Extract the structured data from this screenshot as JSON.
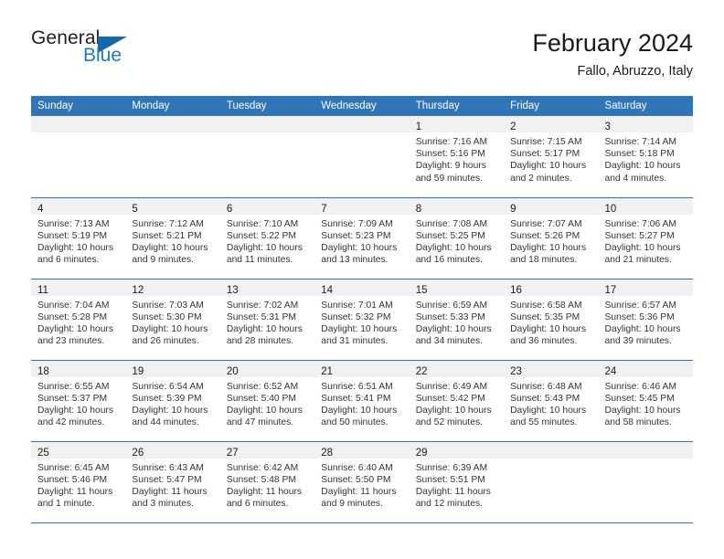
{
  "brand": {
    "name_part1": "General",
    "name_part2": "Blue",
    "logo_icon": "triangle-logo-icon"
  },
  "header": {
    "title": "February 2024",
    "subtitle": "Fallo, Abruzzo, Italy"
  },
  "colors": {
    "header_blue": "#2E76B8",
    "brand_blue": "#1E7AC4",
    "daynum_strip": "#F1F1F1",
    "text": "#333333"
  },
  "weekday_headers": [
    "Sunday",
    "Monday",
    "Tuesday",
    "Wednesday",
    "Thursday",
    "Friday",
    "Saturday"
  ],
  "weeks": [
    [
      {
        "day": "",
        "lines": []
      },
      {
        "day": "",
        "lines": []
      },
      {
        "day": "",
        "lines": []
      },
      {
        "day": "",
        "lines": []
      },
      {
        "day": "1",
        "lines": [
          "Sunrise: 7:16 AM",
          "Sunset: 5:16 PM",
          "Daylight: 9 hours",
          "and 59 minutes."
        ]
      },
      {
        "day": "2",
        "lines": [
          "Sunrise: 7:15 AM",
          "Sunset: 5:17 PM",
          "Daylight: 10 hours",
          "and 2 minutes."
        ]
      },
      {
        "day": "3",
        "lines": [
          "Sunrise: 7:14 AM",
          "Sunset: 5:18 PM",
          "Daylight: 10 hours",
          "and 4 minutes."
        ]
      }
    ],
    [
      {
        "day": "4",
        "lines": [
          "Sunrise: 7:13 AM",
          "Sunset: 5:19 PM",
          "Daylight: 10 hours",
          "and 6 minutes."
        ]
      },
      {
        "day": "5",
        "lines": [
          "Sunrise: 7:12 AM",
          "Sunset: 5:21 PM",
          "Daylight: 10 hours",
          "and 9 minutes."
        ]
      },
      {
        "day": "6",
        "lines": [
          "Sunrise: 7:10 AM",
          "Sunset: 5:22 PM",
          "Daylight: 10 hours",
          "and 11 minutes."
        ]
      },
      {
        "day": "7",
        "lines": [
          "Sunrise: 7:09 AM",
          "Sunset: 5:23 PM",
          "Daylight: 10 hours",
          "and 13 minutes."
        ]
      },
      {
        "day": "8",
        "lines": [
          "Sunrise: 7:08 AM",
          "Sunset: 5:25 PM",
          "Daylight: 10 hours",
          "and 16 minutes."
        ]
      },
      {
        "day": "9",
        "lines": [
          "Sunrise: 7:07 AM",
          "Sunset: 5:26 PM",
          "Daylight: 10 hours",
          "and 18 minutes."
        ]
      },
      {
        "day": "10",
        "lines": [
          "Sunrise: 7:06 AM",
          "Sunset: 5:27 PM",
          "Daylight: 10 hours",
          "and 21 minutes."
        ]
      }
    ],
    [
      {
        "day": "11",
        "lines": [
          "Sunrise: 7:04 AM",
          "Sunset: 5:28 PM",
          "Daylight: 10 hours",
          "and 23 minutes."
        ]
      },
      {
        "day": "12",
        "lines": [
          "Sunrise: 7:03 AM",
          "Sunset: 5:30 PM",
          "Daylight: 10 hours",
          "and 26 minutes."
        ]
      },
      {
        "day": "13",
        "lines": [
          "Sunrise: 7:02 AM",
          "Sunset: 5:31 PM",
          "Daylight: 10 hours",
          "and 28 minutes."
        ]
      },
      {
        "day": "14",
        "lines": [
          "Sunrise: 7:01 AM",
          "Sunset: 5:32 PM",
          "Daylight: 10 hours",
          "and 31 minutes."
        ]
      },
      {
        "day": "15",
        "lines": [
          "Sunrise: 6:59 AM",
          "Sunset: 5:33 PM",
          "Daylight: 10 hours",
          "and 34 minutes."
        ]
      },
      {
        "day": "16",
        "lines": [
          "Sunrise: 6:58 AM",
          "Sunset: 5:35 PM",
          "Daylight: 10 hours",
          "and 36 minutes."
        ]
      },
      {
        "day": "17",
        "lines": [
          "Sunrise: 6:57 AM",
          "Sunset: 5:36 PM",
          "Daylight: 10 hours",
          "and 39 minutes."
        ]
      }
    ],
    [
      {
        "day": "18",
        "lines": [
          "Sunrise: 6:55 AM",
          "Sunset: 5:37 PM",
          "Daylight: 10 hours",
          "and 42 minutes."
        ]
      },
      {
        "day": "19",
        "lines": [
          "Sunrise: 6:54 AM",
          "Sunset: 5:39 PM",
          "Daylight: 10 hours",
          "and 44 minutes."
        ]
      },
      {
        "day": "20",
        "lines": [
          "Sunrise: 6:52 AM",
          "Sunset: 5:40 PM",
          "Daylight: 10 hours",
          "and 47 minutes."
        ]
      },
      {
        "day": "21",
        "lines": [
          "Sunrise: 6:51 AM",
          "Sunset: 5:41 PM",
          "Daylight: 10 hours",
          "and 50 minutes."
        ]
      },
      {
        "day": "22",
        "lines": [
          "Sunrise: 6:49 AM",
          "Sunset: 5:42 PM",
          "Daylight: 10 hours",
          "and 52 minutes."
        ]
      },
      {
        "day": "23",
        "lines": [
          "Sunrise: 6:48 AM",
          "Sunset: 5:43 PM",
          "Daylight: 10 hours",
          "and 55 minutes."
        ]
      },
      {
        "day": "24",
        "lines": [
          "Sunrise: 6:46 AM",
          "Sunset: 5:45 PM",
          "Daylight: 10 hours",
          "and 58 minutes."
        ]
      }
    ],
    [
      {
        "day": "25",
        "lines": [
          "Sunrise: 6:45 AM",
          "Sunset: 5:46 PM",
          "Daylight: 11 hours",
          "and 1 minute."
        ]
      },
      {
        "day": "26",
        "lines": [
          "Sunrise: 6:43 AM",
          "Sunset: 5:47 PM",
          "Daylight: 11 hours",
          "and 3 minutes."
        ]
      },
      {
        "day": "27",
        "lines": [
          "Sunrise: 6:42 AM",
          "Sunset: 5:48 PM",
          "Daylight: 11 hours",
          "and 6 minutes."
        ]
      },
      {
        "day": "28",
        "lines": [
          "Sunrise: 6:40 AM",
          "Sunset: 5:50 PM",
          "Daylight: 11 hours",
          "and 9 minutes."
        ]
      },
      {
        "day": "29",
        "lines": [
          "Sunrise: 6:39 AM",
          "Sunset: 5:51 PM",
          "Daylight: 11 hours",
          "and 12 minutes."
        ]
      },
      {
        "day": "",
        "lines": []
      },
      {
        "day": "",
        "lines": []
      }
    ]
  ]
}
